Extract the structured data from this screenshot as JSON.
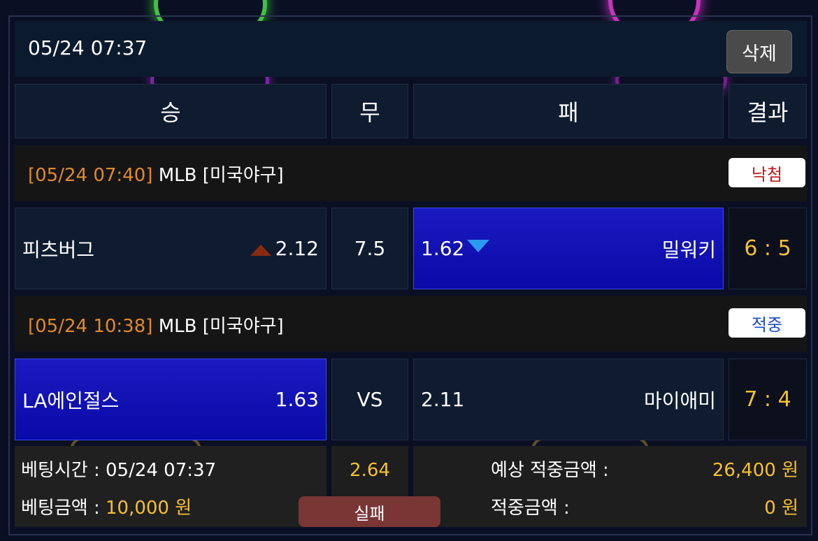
{
  "header": {
    "datetime": "05/24 07:37",
    "delete_label": "삭제"
  },
  "columns": {
    "win": "승",
    "draw": "무",
    "lose": "패",
    "result": "결과"
  },
  "games": [
    {
      "date": "[05/24 07:40]",
      "league": "MLB [미국야구]",
      "status": "낙첨",
      "status_color": "#c01818",
      "home": {
        "name": "피츠버그",
        "odds": "2.12",
        "arrow": "up-arrow-icon"
      },
      "center": "7.5",
      "away": {
        "name": "밀워키",
        "odds": "1.62",
        "arrow": "down-arrow-icon"
      },
      "score": "6 : 5",
      "selected": "away"
    },
    {
      "date": "[05/24 10:38]",
      "league": "MLB [미국야구]",
      "status": "적중",
      "status_color": "#1a4ad0",
      "home": {
        "name": "LA에인절스",
        "odds": "1.63"
      },
      "center": "VS",
      "away": {
        "name": "마이애미",
        "odds": "2.11"
      },
      "score": "7 : 4",
      "selected": "home"
    }
  ],
  "summary": {
    "bet_time_label": "베팅시간 :",
    "bet_time": "05/24 07:37",
    "bet_amount_label": "베팅금액 :",
    "bet_amount": "10,000 원",
    "total_odds": "2.64",
    "result_label": "실패",
    "expected_label": "예상 적중금액 :",
    "expected_amount": "26,400 원",
    "win_label": "적중금액 :",
    "win_amount": "0 원"
  },
  "colors": {
    "accent_orange": "#e08a2a",
    "accent_yellow": "#f5c030",
    "selected_blue": "#1414b8"
  }
}
